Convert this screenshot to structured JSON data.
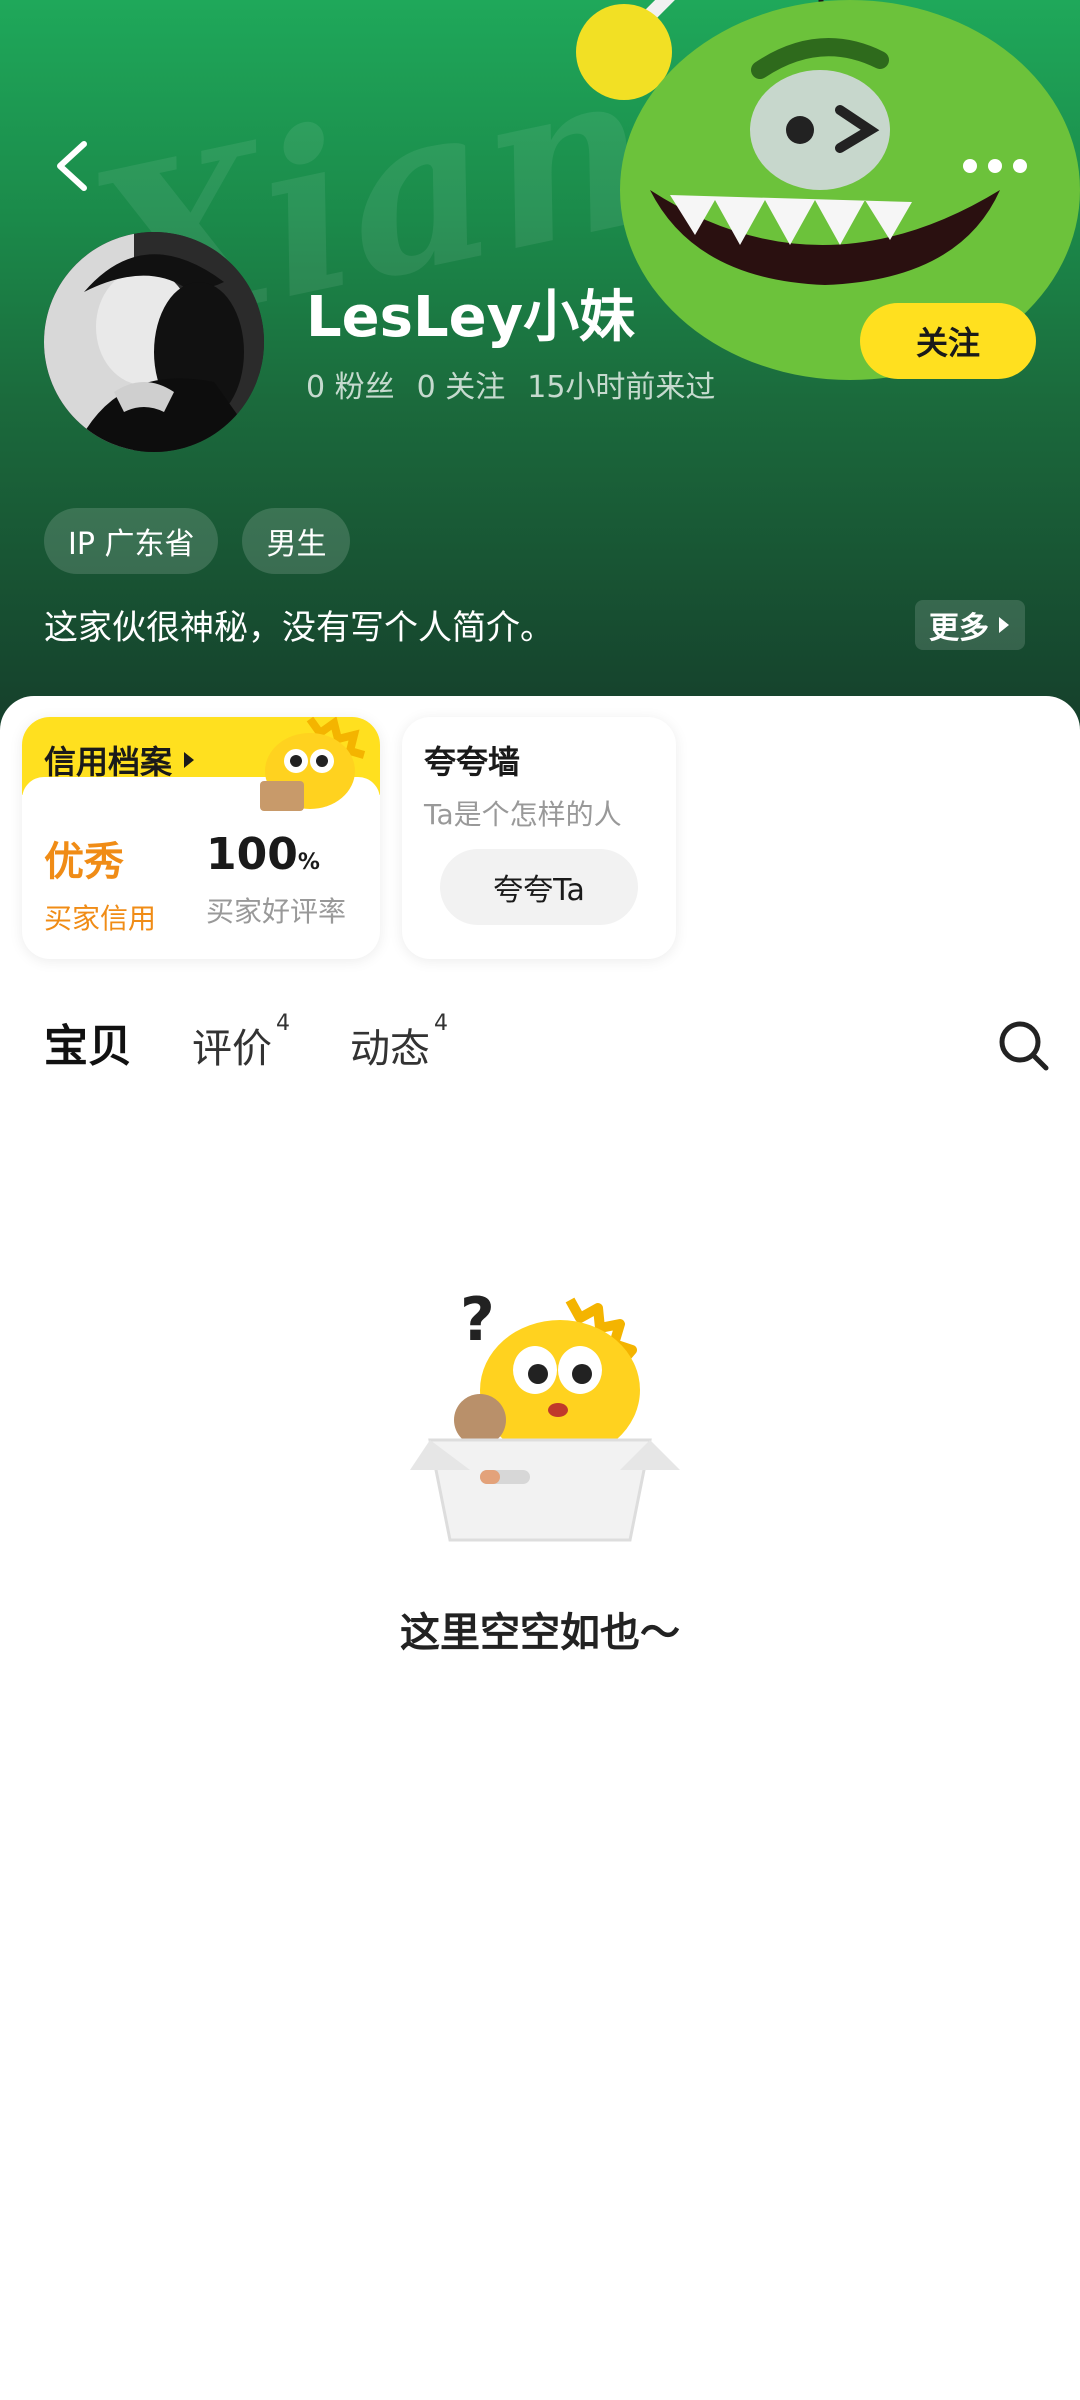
{
  "header": {
    "username": "LesLey小妹",
    "stats": {
      "fans": "0 粉丝",
      "following": "0 关注",
      "last_seen": "15小时前来过"
    },
    "follow_label": "关注",
    "tags": [
      "IP 广东省",
      "男生"
    ],
    "bio": "这家伙很神秘，没有写个人简介。",
    "more_label": "更多"
  },
  "credit": {
    "title": "信用档案",
    "rating": "优秀",
    "rating_label": "买家信用",
    "praise_rate_value": "100",
    "praise_rate_unit": "%",
    "praise_rate_label": "买家好评率"
  },
  "praise_wall": {
    "title": "夸夸墙",
    "subtitle": "Ta是个怎样的人",
    "button_label": "夸夸Ta"
  },
  "tabs": [
    {
      "label": "宝贝",
      "count": ""
    },
    {
      "label": "评价",
      "count": "4"
    },
    {
      "label": "动态",
      "count": "4"
    }
  ],
  "empty_state": {
    "message": "这里空空如也～"
  },
  "colors": {
    "accent_yellow": "#ffe01f",
    "header_green": "#1b8a4a",
    "credit_orange": "#f08c16"
  },
  "icons": {
    "back": "chevron-left-icon",
    "more": "more-dots-icon",
    "search": "search-icon"
  }
}
